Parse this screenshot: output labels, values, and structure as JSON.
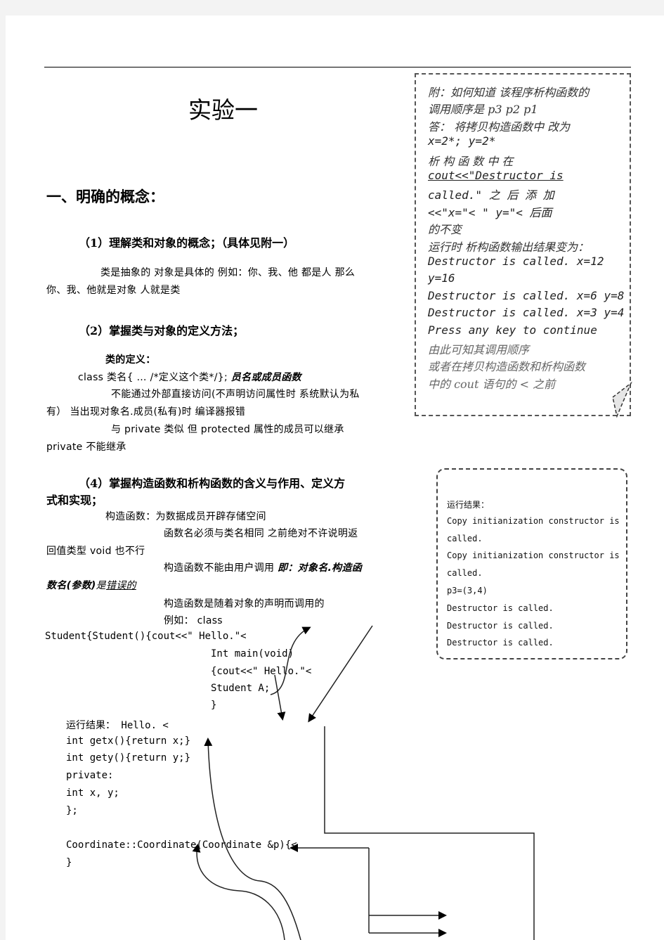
{
  "document": {
    "title": "实验一",
    "section1_heading": "一、明确的概念：",
    "item1_heading": "（1）理解类和对象的概念；（具体见附一）",
    "item1_body": [
      "类是抽象的 对象是具体的 例如：你、我、他 都是人 那么",
      "你、我、他就是对象 人就是类"
    ],
    "item2_heading": "（2）掌握类与对象的定义方法；",
    "class_def_label": "类的定义：",
    "class_def_code": "class 类名{ … /*定义这个类*/};",
    "class_def_emph": "员名或成员函数",
    "private_note": [
      "不能通过外部直接访问(不声明访问属性时 系统默认为私",
      "有） 当出现对象名.成员(私有)时 编译器报错"
    ],
    "protected_note": [
      "与 private 类似 但 protected 属性的成员可以继承",
      "private 不能继承"
    ],
    "item4_heading": [
      "（4）掌握构造函数和析构函数的含义与作用、定义方",
      "式和实现；"
    ],
    "ctor_lines": {
      "l1": "构造函数：为数据成员开辟存储空间",
      "l2": "函数名必须与类名相同 之前绝对不许说明返",
      "l3": "回值类型 void 也不行",
      "l4a": "构造函数不能由用户调用 ",
      "l4b": "即：对象名.构造函",
      "l5a": "数名(参数)",
      "l5b": "是",
      "l5c": "错误的",
      "l6": "构造函数是随着对象的声明而调用的",
      "l7": "例如：   class"
    },
    "example_code": [
      "Student{Student(){cout<<\" Hello.\"<",
      "Int main(void)",
      "{cout<<\" Hello.\"<",
      "Student A;",
      "}"
    ],
    "run_result_label": "运行结果：   Hello.  <",
    "class_body_code": [
      " int getx(){return x;}",
      " int gety(){return y;}",
      "private:",
      " int x, y;",
      "};",
      "",
      "Coordinate::Coordinate(Coordinate &p){<",
      "}"
    ]
  },
  "note_box": {
    "lines": [
      {
        "text": "附：如何知道 该程序析构函数的",
        "style": "cn"
      },
      {
        "text": "调用顺序是 p3 p2 p1",
        "style": "cn"
      },
      {
        "text": "答： 将拷贝构造函数中  改为",
        "style": "cn"
      },
      {
        "text": "x=2*; y=2*",
        "style": "mono"
      },
      {
        "text": "析   构   函   数   中       在",
        "style": "cn"
      },
      {
        "text": "cout<<\"Destructor          is",
        "style": "mono-ul"
      },
      {
        "text": "called.\"    之   后   添   加",
        "style": "mono"
      },
      {
        "text": "<<\"x=\"<    \"  y=\"<  后面",
        "style": "mono"
      },
      {
        "text": "的不变",
        "style": "cn"
      },
      {
        "text": "运行时 析构函数输出结果变为：",
        "style": "cn"
      },
      {
        "text": "Destructor  is  called.  x=12",
        "style": "mono"
      },
      {
        "text": "y=16",
        "style": "mono"
      },
      {
        "text": "Destructor is called. x=6 y=8",
        "style": "mono"
      },
      {
        "text": "Destructor is called. x=3 y=4",
        "style": "mono"
      },
      {
        "text": "Press any key to continue",
        "style": "mono"
      },
      {
        "text": "由此可知其调用顺序",
        "style": "cn-gray"
      },
      {
        "text": "或者在拷贝构造函数和析构函数",
        "style": "cn-gray"
      },
      {
        "text": "中的 cout 语句的 <       之前",
        "style": "cn-gray"
      }
    ]
  },
  "result_box": {
    "lines": [
      "运行结果：",
      "Copy initianization constructor is",
      "called.",
      "Copy initianization constructor is",
      "called.",
      "p3=(3,4)",
      "Destructor is called.",
      "Destructor is called.",
      "Destructor is called."
    ]
  }
}
